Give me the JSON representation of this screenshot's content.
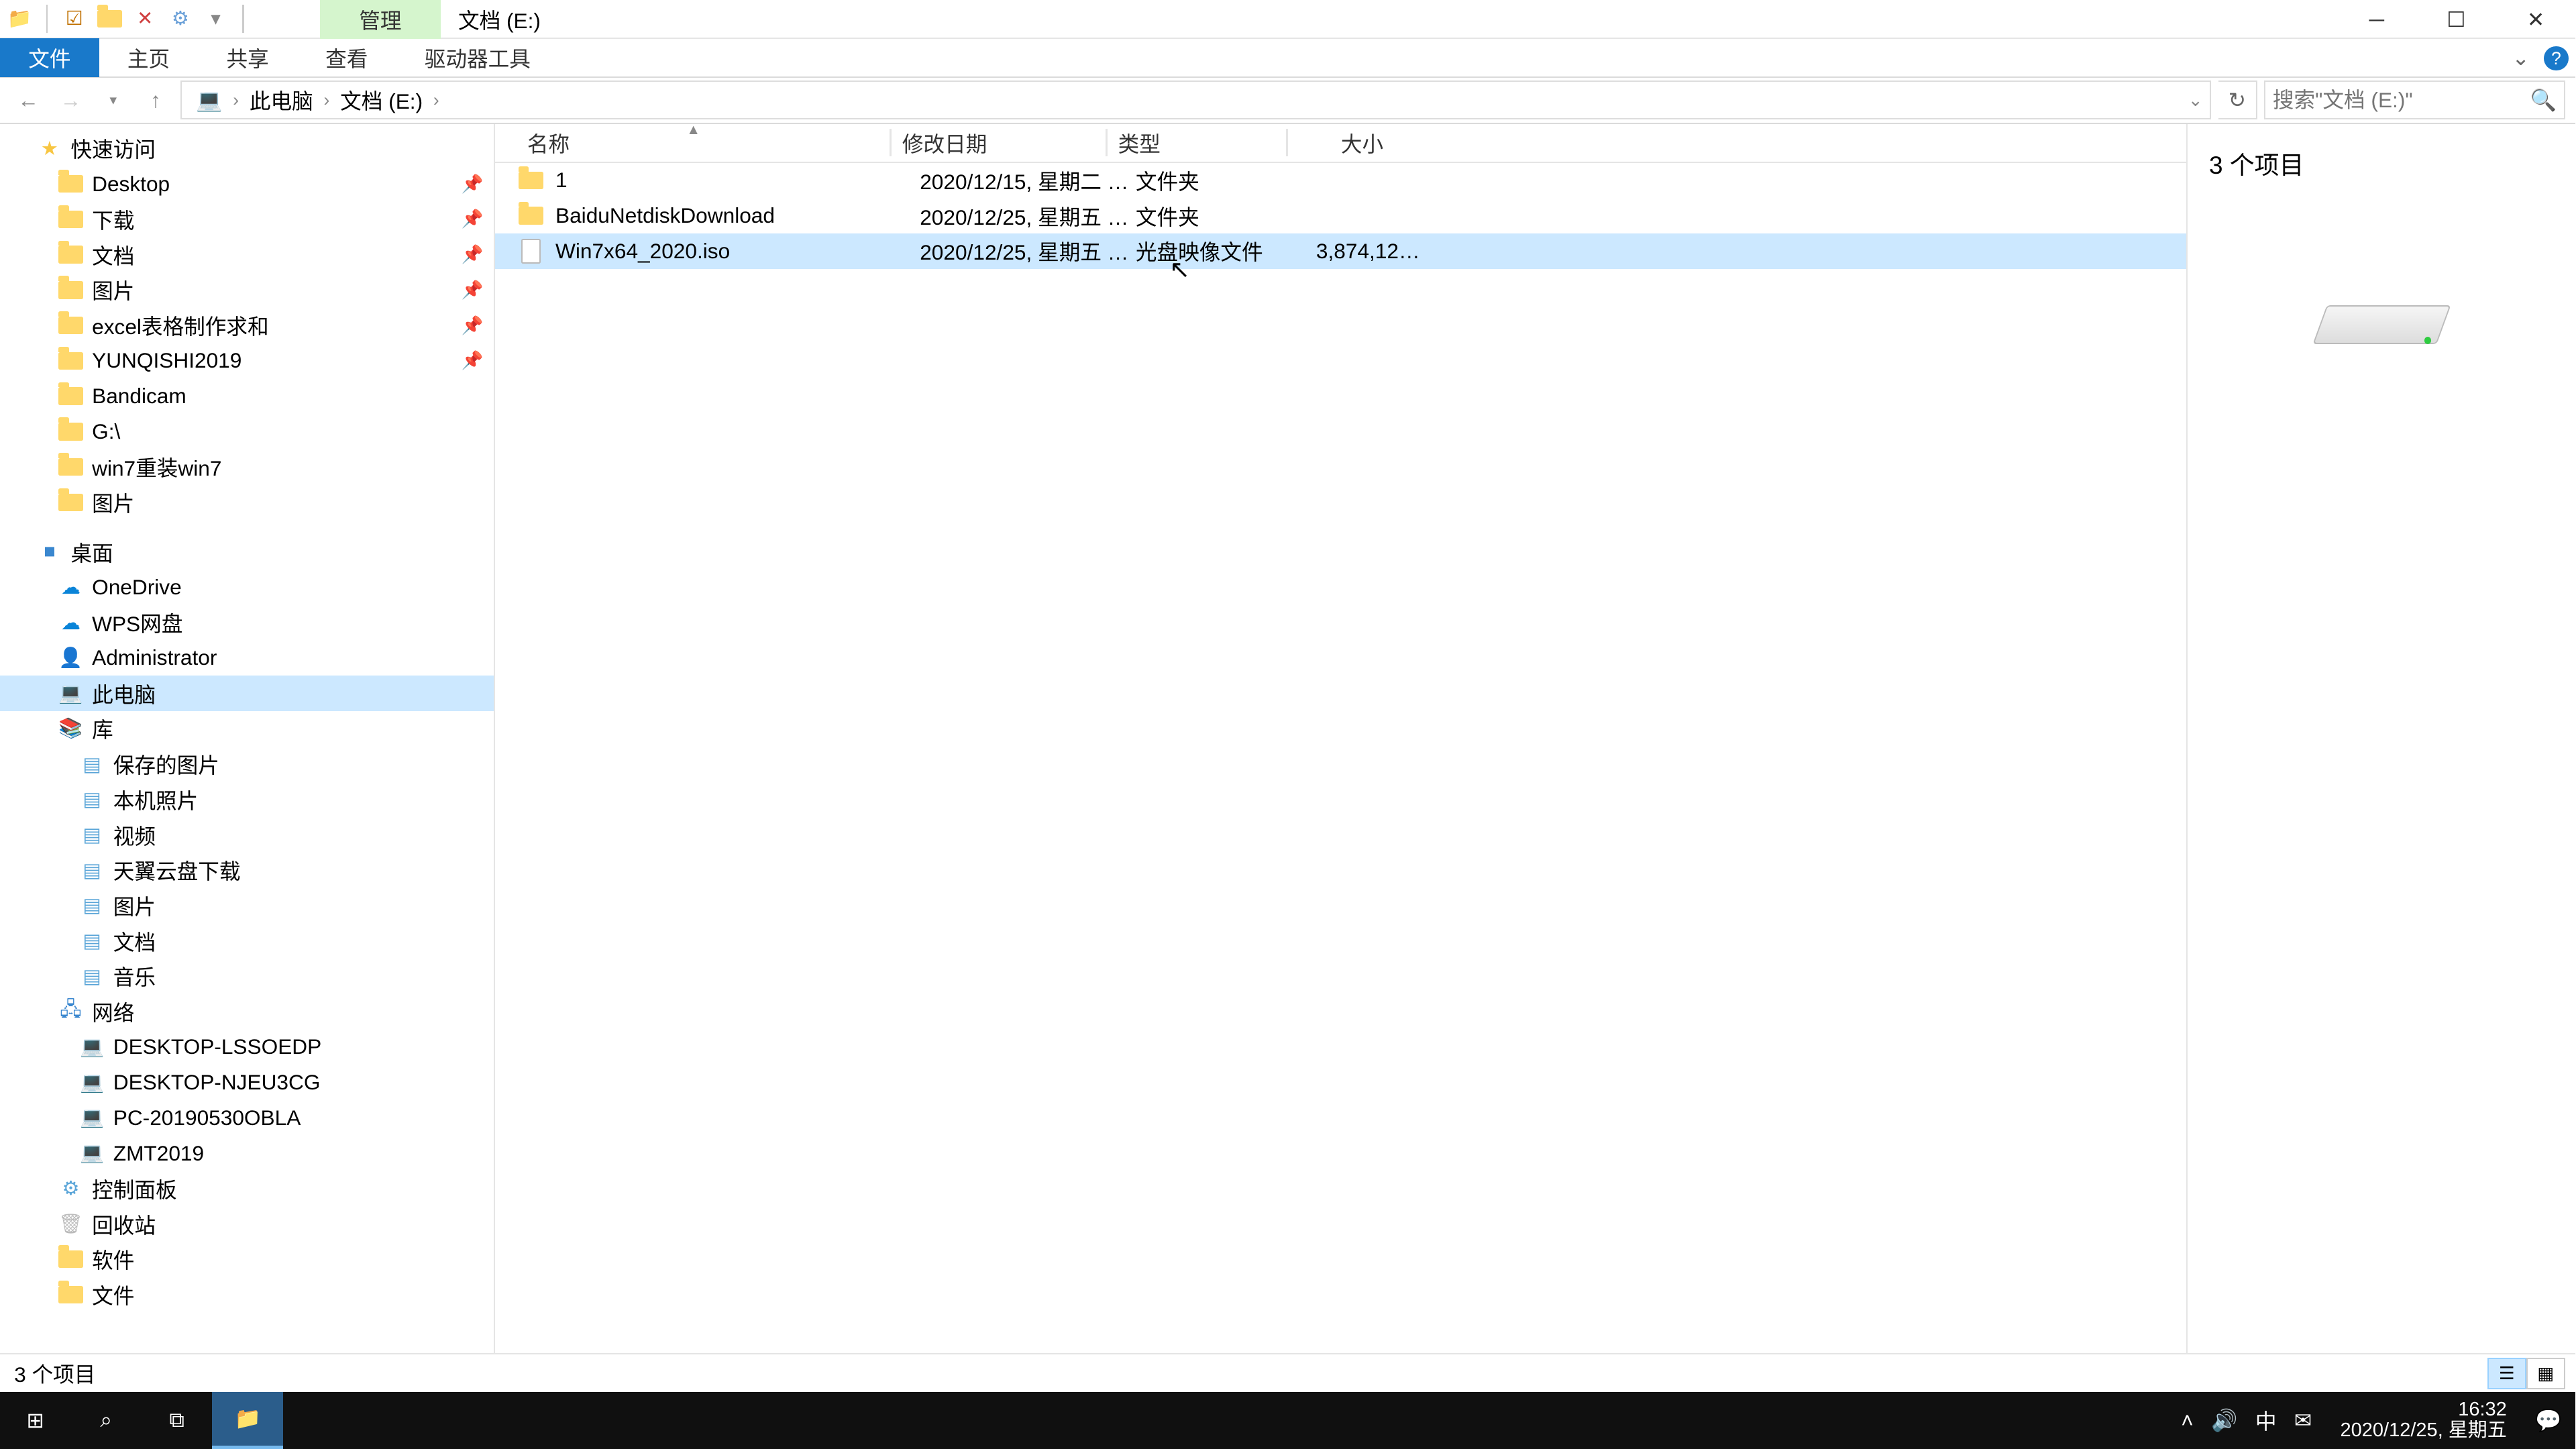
{
  "title_bar": {
    "ribbon_context_tab": "管理",
    "window_title": "文档 (E:)"
  },
  "ribbon_tabs": {
    "file": "文件",
    "home": "主页",
    "share": "共享",
    "view": "查看",
    "drive_tools": "驱动器工具"
  },
  "breadcrumb": {
    "pc": "此电脑",
    "location": "文档 (E:)"
  },
  "search": {
    "placeholder": "搜索\"文档 (E:)\""
  },
  "sidebar": {
    "quick_access": "快速访问",
    "quick_items": [
      {
        "label": "Desktop",
        "pinned": true
      },
      {
        "label": "下载",
        "pinned": true
      },
      {
        "label": "文档",
        "pinned": true
      },
      {
        "label": "图片",
        "pinned": true
      },
      {
        "label": "excel表格制作求和",
        "pinned": true
      },
      {
        "label": "YUNQISHI2019",
        "pinned": true
      },
      {
        "label": "Bandicam",
        "pinned": false
      },
      {
        "label": "G:\\",
        "pinned": false
      },
      {
        "label": "win7重装win7",
        "pinned": false
      },
      {
        "label": "图片",
        "pinned": false
      }
    ],
    "desktop": "桌面",
    "desktop_items": [
      "OneDrive",
      "WPS网盘",
      "Administrator",
      "此电脑",
      "库"
    ],
    "library_items": [
      "保存的图片",
      "本机照片",
      "视频",
      "天翼云盘下载",
      "图片",
      "文档",
      "音乐"
    ],
    "network": "网络",
    "network_items": [
      "DESKTOP-LSSOEDP",
      "DESKTOP-NJEU3CG",
      "PC-20190530OBLA",
      "ZMT2019"
    ],
    "control_panel": "控制面板",
    "recycle": "回收站",
    "software": "软件",
    "files_folder": "文件"
  },
  "columns": {
    "name": "名称",
    "date": "修改日期",
    "type": "类型",
    "size": "大小"
  },
  "files": [
    {
      "name": "1",
      "date": "2020/12/15, 星期二 1...",
      "type": "文件夹",
      "size": "",
      "icon": "folder",
      "selected": false
    },
    {
      "name": "BaiduNetdiskDownload",
      "date": "2020/12/25, 星期五 1...",
      "type": "文件夹",
      "size": "",
      "icon": "folder",
      "selected": false
    },
    {
      "name": "Win7x64_2020.iso",
      "date": "2020/12/25, 星期五 1...",
      "type": "光盘映像文件",
      "size": "3,874,126...",
      "icon": "file",
      "selected": true
    }
  ],
  "preview": {
    "summary": "3 个项目"
  },
  "status": {
    "text": "3 个项目"
  },
  "taskbar": {
    "time": "16:32",
    "date": "2020/12/25, 星期五",
    "ime": "中"
  }
}
